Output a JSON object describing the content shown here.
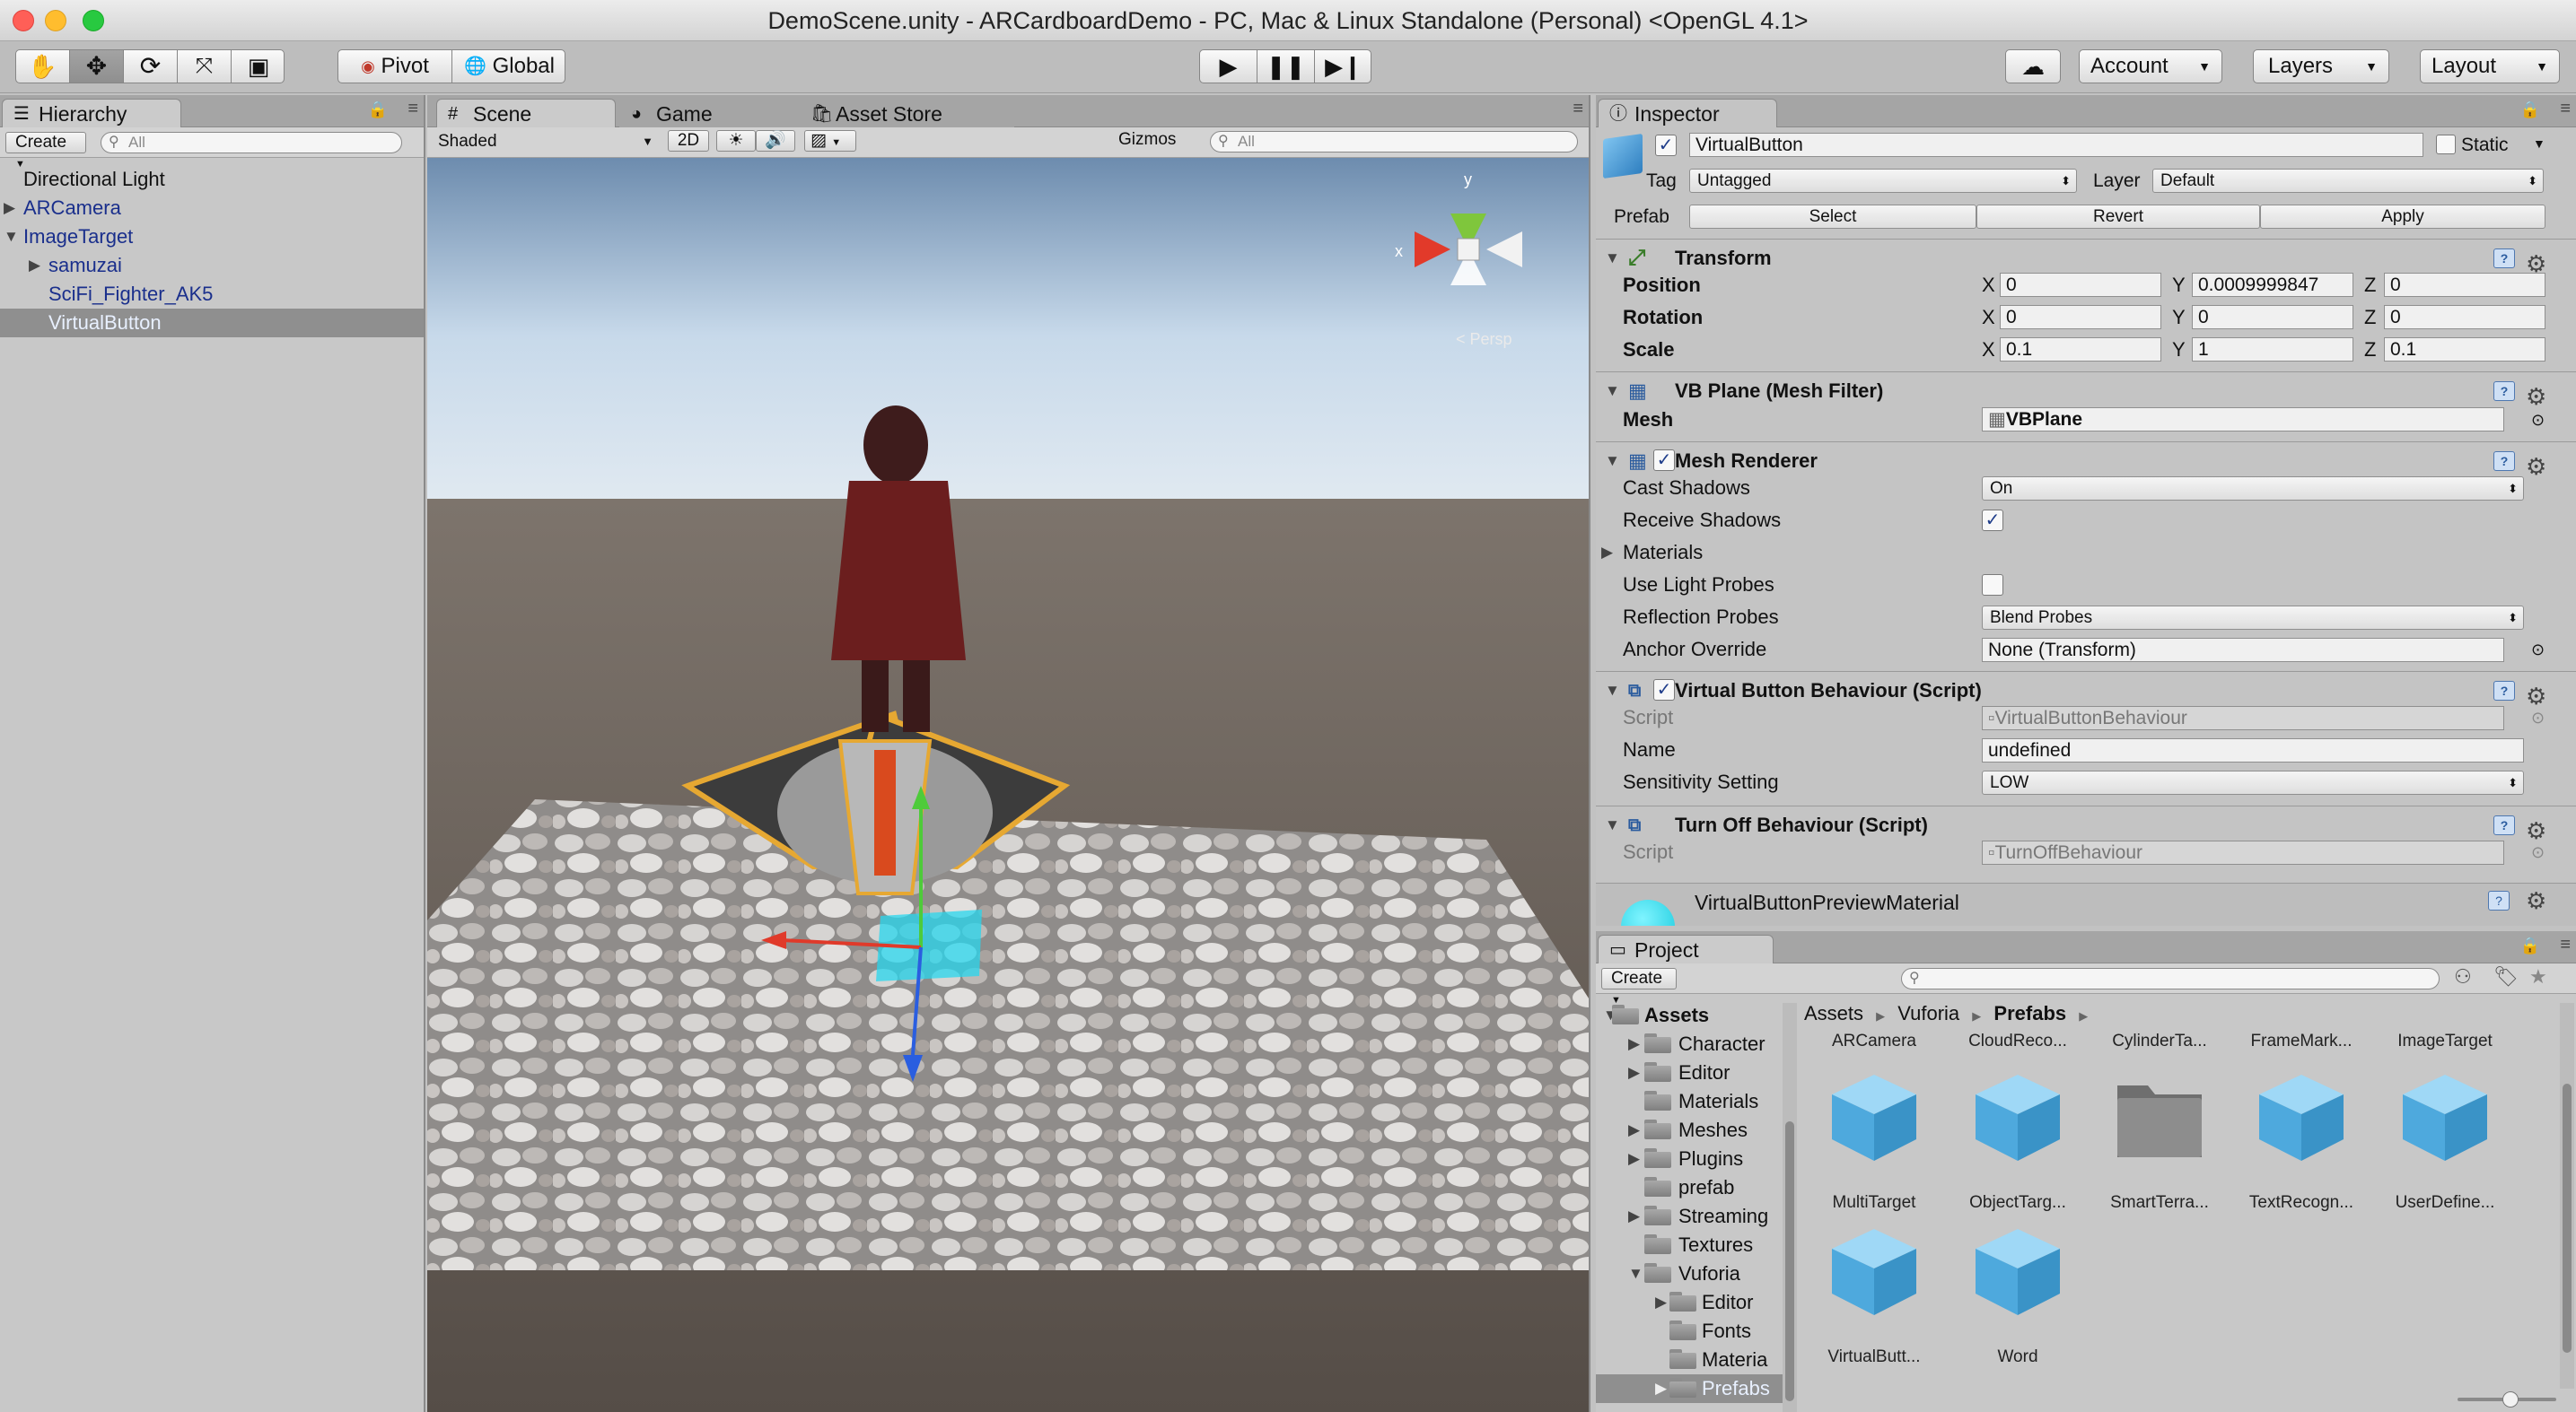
{
  "window": {
    "title": "DemoScene.unity - ARCardboardDemo - PC, Mac & Linux Standalone (Personal) <OpenGL 4.1>"
  },
  "toolbar": {
    "pivot_label": "Pivot",
    "global_label": "Global",
    "account_label": "Account",
    "layers_label": "Layers",
    "layout_label": "Layout"
  },
  "hierarchy": {
    "tab_label": "Hierarchy",
    "create_label": "Create",
    "search_placeholder": "All",
    "items": [
      {
        "label": "Directional Light"
      },
      {
        "label": "ARCamera"
      },
      {
        "label": "ImageTarget"
      },
      {
        "label": "samuzai"
      },
      {
        "label": "SciFi_Fighter_AK5"
      },
      {
        "label": "VirtualButton"
      }
    ]
  },
  "scene": {
    "tabs": [
      {
        "label": "Scene"
      },
      {
        "label": "Game"
      },
      {
        "label": "Asset Store"
      }
    ],
    "shading_mode": "Shaded",
    "toggle_2d": "2D",
    "gizmos_label": "Gizmos",
    "search_placeholder": "All",
    "gizmo_axes": {
      "y": "y",
      "x": "x"
    },
    "gizmo_persp": "< Persp"
  },
  "inspector": {
    "tab_label": "Inspector",
    "object_name": "VirtualButton",
    "static_label": "Static",
    "tag_label": "Tag",
    "tag_value": "Untagged",
    "layer_label": "Layer",
    "layer_value": "Default",
    "prefab_label": "Prefab",
    "prefab_select": "Select",
    "prefab_revert": "Revert",
    "prefab_apply": "Apply",
    "transform": {
      "title": "Transform",
      "rows": [
        {
          "label": "Position",
          "x": "0",
          "y": "0.0009999847",
          "z": "0"
        },
        {
          "label": "Rotation",
          "x": "0",
          "y": "0",
          "z": "0"
        },
        {
          "label": "Scale",
          "x": "0.1",
          "y": "1",
          "z": "0.1"
        }
      ],
      "axis_x": "X",
      "axis_y": "Y",
      "axis_z": "Z"
    },
    "mesh_filter": {
      "title": "VB Plane (Mesh Filter)",
      "mesh_label": "Mesh",
      "mesh_value": "VBPlane"
    },
    "mesh_renderer": {
      "title": "Mesh Renderer",
      "cast_shadows_label": "Cast Shadows",
      "cast_shadows_value": "On",
      "receive_shadows_label": "Receive Shadows",
      "materials_label": "Materials",
      "light_probes_label": "Use Light Probes",
      "reflection_probes_label": "Reflection Probes",
      "reflection_probes_value": "Blend Probes",
      "anchor_override_label": "Anchor Override",
      "anchor_override_value": "None (Transform)"
    },
    "vb_behaviour": {
      "title": "Virtual Button Behaviour (Script)",
      "script_label": "Script",
      "script_value": "VirtualButtonBehaviour",
      "name_label": "Name",
      "name_value": "undefined",
      "sensitivity_label": "Sensitivity Setting",
      "sensitivity_value": "LOW"
    },
    "turnoff": {
      "title": "Turn Off Behaviour (Script)",
      "script_label": "Script",
      "script_value": "TurnOffBehaviour"
    },
    "material": {
      "title": "VirtualButtonPreviewMaterial"
    }
  },
  "project": {
    "tab_label": "Project",
    "create_label": "Create",
    "breadcrumb": [
      "Assets",
      "Vuforia",
      "Prefabs"
    ],
    "tree": [
      {
        "label": "Assets"
      },
      {
        "label": "Character"
      },
      {
        "label": "Editor"
      },
      {
        "label": "Materials"
      },
      {
        "label": "Meshes"
      },
      {
        "label": "Plugins"
      },
      {
        "label": "prefab"
      },
      {
        "label": "Streaming"
      },
      {
        "label": "Textures"
      },
      {
        "label": "Vuforia"
      },
      {
        "label": "Editor"
      },
      {
        "label": "Fonts"
      },
      {
        "label": "Materia"
      },
      {
        "label": "Prefabs"
      }
    ],
    "top_labels": [
      {
        "label": "ARCamera"
      },
      {
        "label": "CloudReco..."
      },
      {
        "label": "CylinderTa..."
      },
      {
        "label": "FrameMark..."
      },
      {
        "label": "ImageTarget"
      }
    ],
    "assets": [
      {
        "label": "MultiTarget",
        "kind": "cube"
      },
      {
        "label": "ObjectTarg...",
        "kind": "cube"
      },
      {
        "label": "SmartTerra...",
        "kind": "folder"
      },
      {
        "label": "TextRecogn...",
        "kind": "cube"
      },
      {
        "label": "UserDefine...",
        "kind": "cube"
      },
      {
        "label": "VirtualButt...",
        "kind": "cube"
      },
      {
        "label": "Word",
        "kind": "cube"
      }
    ]
  },
  "colors": {
    "accent_blue": "#1a2f8c",
    "selection": "#8f8f8f",
    "cube": "#5cb6ea"
  }
}
